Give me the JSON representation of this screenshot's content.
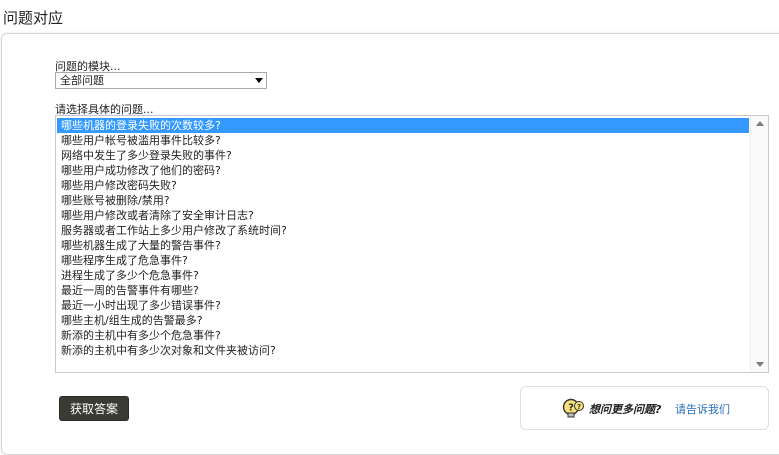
{
  "page": {
    "title": "问题对应"
  },
  "module": {
    "label": "问题的模块...",
    "selected": "全部问题"
  },
  "questions": {
    "label": "请选择具体的问题...",
    "items": [
      "哪些机器的登录失败的次数较多?",
      "哪些用户帐号被滥用事件比较多?",
      "网络中发生了多少登录失败的事件?",
      "哪些用户成功修改了他们的密码?",
      "哪些用户修改密码失败?",
      "哪些账号被删除/禁用?",
      "哪些用户修改或者清除了安全审计日志?",
      "服务器或者工作站上多少用户修改了系统时间?",
      "哪些机器生成了大量的警告事件?",
      "哪些程序生成了危急事件?",
      "进程生成了多少个危急事件?",
      "最近一周的告警事件有哪些?",
      "最近一小时出现了多少错误事件?",
      "哪些主机/组生成的告警最多?",
      "新添的主机中有多少个危急事件?",
      "新添的主机中有多少次对象和文件夹被访问?"
    ],
    "selected_index": 0
  },
  "actions": {
    "submit": "获取答案"
  },
  "more": {
    "text": "想问更多问题?",
    "link": "请告诉我们",
    "icon": "question-bulb-icon"
  },
  "colors": {
    "selection": "#3399ff",
    "button_bg": "#3b3b33",
    "link": "#2a6fb8"
  }
}
